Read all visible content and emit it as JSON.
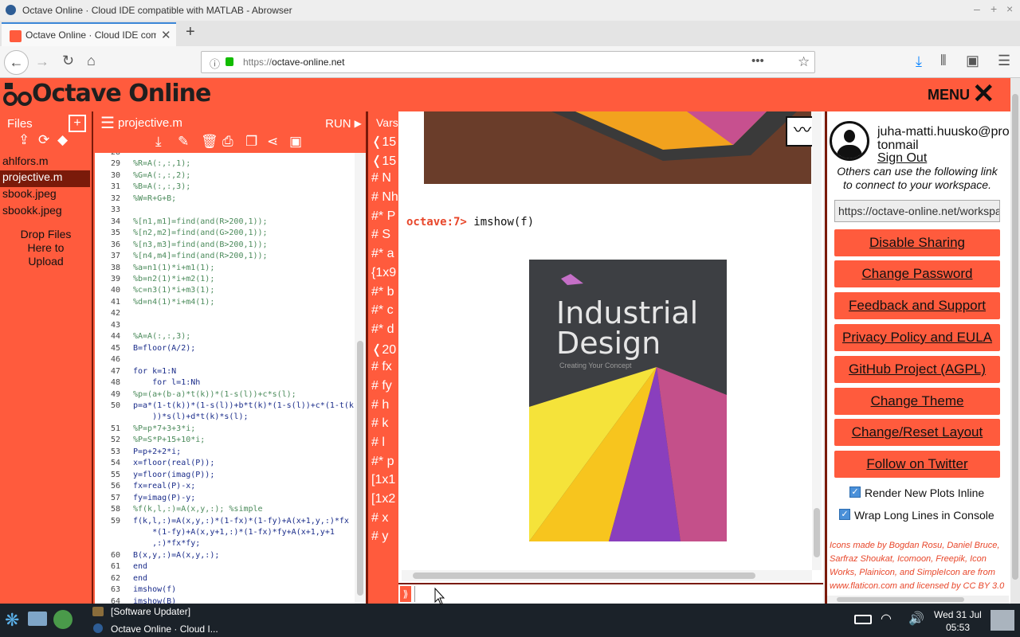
{
  "window": {
    "title": "Octave Online · Cloud IDE compatible with MATLAB - Abrowser"
  },
  "tab": {
    "label": "Octave Online · Cloud IDE com"
  },
  "nav": {
    "url_scheme": "https://",
    "url_host": "octave-online.net"
  },
  "app": {
    "logo": "Octave Online",
    "menu_label": "MENU"
  },
  "files": {
    "header": "Files",
    "items": [
      "ahlfors.m",
      "projective.m",
      "sbook.jpeg",
      "sbookk.jpeg"
    ],
    "selected": 1,
    "drop_hint": "Drop Files Here to Upload"
  },
  "editor": {
    "filename": "projective.m",
    "run_label": "RUN",
    "lines": [
      {
        "n": "28",
        "t": ""
      },
      {
        "n": "29",
        "t": "%R=A(:,:,1);",
        "c": true
      },
      {
        "n": "30",
        "t": "%G=A(:,:,2);",
        "c": true
      },
      {
        "n": "31",
        "t": "%B=A(:,:,3);",
        "c": true
      },
      {
        "n": "32",
        "t": "%W=R+G+B;",
        "c": true
      },
      {
        "n": "33",
        "t": ""
      },
      {
        "n": "34",
        "t": "%[n1,m1]=find(and(R>200,1));",
        "c": true
      },
      {
        "n": "35",
        "t": "%[n2,m2]=find(and(G>200,1));",
        "c": true
      },
      {
        "n": "36",
        "t": "%[n3,m3]=find(and(B>200,1));",
        "c": true
      },
      {
        "n": "37",
        "t": "%[n4,m4]=find(and(R>200,1));",
        "c": true
      },
      {
        "n": "38",
        "t": "%a=n1(1)*i+m1(1);",
        "c": true
      },
      {
        "n": "39",
        "t": "%b=n2(1)*i+m2(1);",
        "c": true
      },
      {
        "n": "40",
        "t": "%c=n3(1)*i+m3(1);",
        "c": true
      },
      {
        "n": "41",
        "t": "%d=n4(1)*i+m4(1);",
        "c": true
      },
      {
        "n": "42",
        "t": ""
      },
      {
        "n": "43",
        "t": ""
      },
      {
        "n": "44",
        "t": "%A=A(:,:,3);",
        "c": true
      },
      {
        "n": "45",
        "t": "B=floor(A/2);"
      },
      {
        "n": "46",
        "t": ""
      },
      {
        "n": "47",
        "t": "for k=1:N"
      },
      {
        "n": "48",
        "t": "    for l=1:Nh"
      },
      {
        "n": "49",
        "t": "%p=(a+(b-a)*t(k))*(1-s(l))+c*s(l);",
        "c": true
      },
      {
        "n": "50",
        "t": "p=a*(1-t(k))*(1-s(l))+b*t(k)*(1-s(l))+c*(1-t(k"
      },
      {
        "n": "",
        "t": "    ))*s(l)+d*t(k)*s(l);"
      },
      {
        "n": "51",
        "t": "%P=p*7+3+3*i;",
        "c": true
      },
      {
        "n": "52",
        "t": "%P=S*P+15+10*i;",
        "c": true
      },
      {
        "n": "53",
        "t": "P=p+2+2*i;"
      },
      {
        "n": "54",
        "t": "x=floor(real(P));"
      },
      {
        "n": "55",
        "t": "y=floor(imag(P));"
      },
      {
        "n": "56",
        "t": "fx=real(P)-x;"
      },
      {
        "n": "57",
        "t": "fy=imag(P)-y;"
      },
      {
        "n": "58",
        "t": "%f(k,l,:)=A(x,y,:); %simple",
        "c": true
      },
      {
        "n": "59",
        "t": "f(k,l,:)=A(x,y,:)*(1-fx)*(1-fy)+A(x+1,y,:)*fx"
      },
      {
        "n": "",
        "t": "    *(1-fy)+A(x,y+1,:)*(1-fx)*fy+A(x+1,y+1"
      },
      {
        "n": "",
        "t": "    ,:)*fx*fy;"
      },
      {
        "n": "60",
        "t": "B(x,y,:)=A(x,y,:);"
      },
      {
        "n": "61",
        "t": "end"
      },
      {
        "n": "62",
        "t": "end"
      },
      {
        "n": "63",
        "t": "imshow(f)"
      },
      {
        "n": "64",
        "t": "imshow(B)"
      }
    ]
  },
  "vars": {
    "header": "Vars",
    "items": [
      "❬15",
      "❬15",
      "# N",
      "# Nh",
      "#* P",
      "# S",
      "#* a",
      "{1x9",
      "#* b",
      "#* c",
      "#* d",
      "❬20",
      "# fx",
      "# fy",
      "# h",
      "# k",
      "# l",
      "#* p",
      "[1x1",
      "[1x2",
      "# x",
      "# y"
    ]
  },
  "console": {
    "prompt": "octave:7>",
    "command": "imshow(f)",
    "book_title": "Industrial Design",
    "book_subtitle": "Creating Your Concept"
  },
  "right": {
    "user": "juha-matti.huusko@protonmail",
    "sign_out": "Sign Out",
    "share_info": "Others can use the following link to connect to your workspace.",
    "share_link": "https://octave-online.net/workspace",
    "buttons": [
      "Disable Sharing",
      "Change Password",
      "Feedback and Support",
      "Privacy Policy and EULA",
      "GitHub Project (AGPL)",
      "Change Theme",
      "Change/Reset Layout",
      "Follow on Twitter"
    ],
    "check1": "Render New Plots Inline",
    "check2": "Wrap Long Lines in Console",
    "credits": "Icons made by Bogdan Rosu, Daniel Bruce, Sarfraz Shoukat, Icomoon, Freepik, Icon Works, Plainicon, and SimpleIcon are from www.flaticon.com and licensed by CC BY 3.0"
  },
  "taskbar": {
    "updater": "[Software Updater]",
    "window": "Octave Online · Cloud I...",
    "date": "Wed 31 Jul",
    "time": "05:53"
  }
}
